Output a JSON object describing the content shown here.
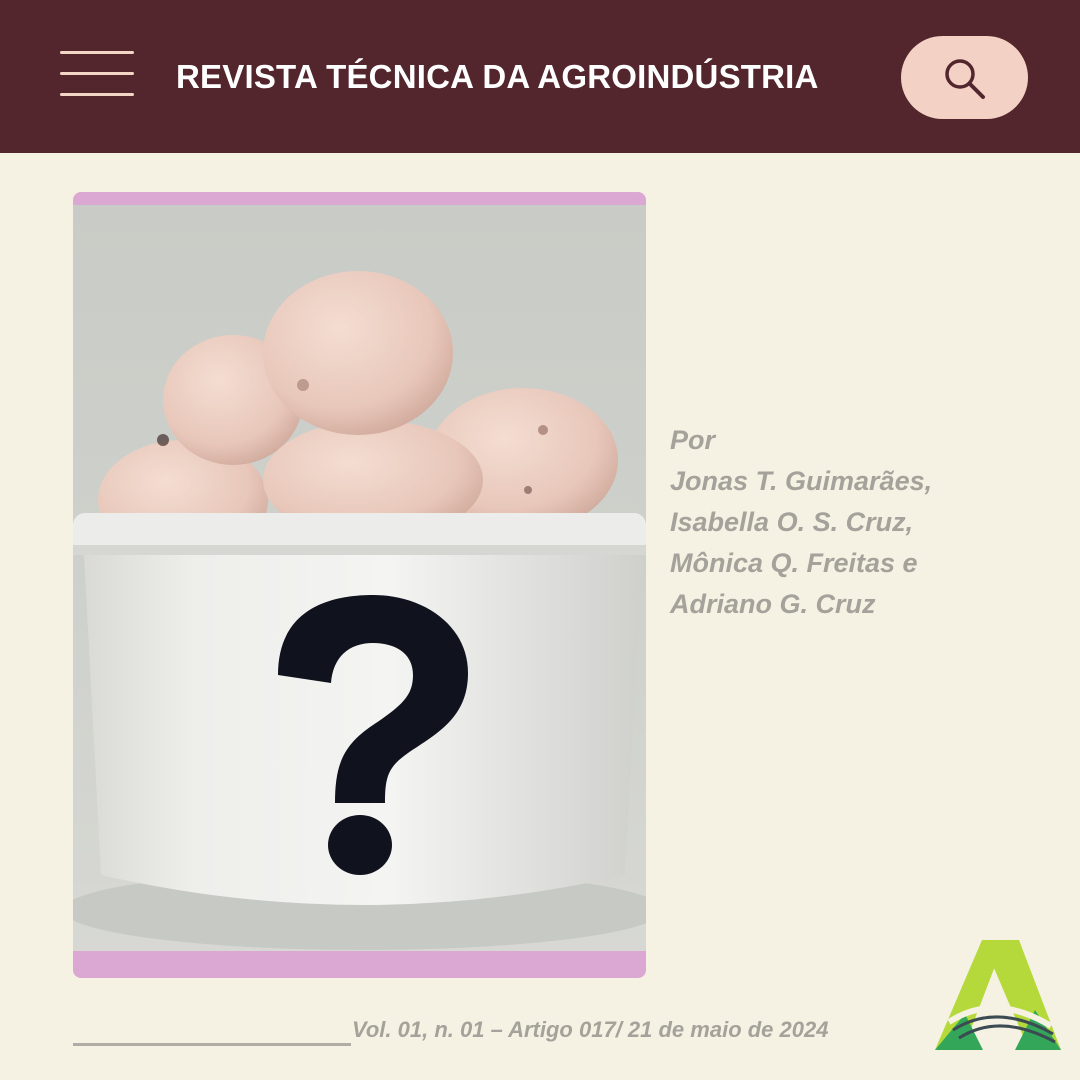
{
  "header": {
    "title": "REVISTA TÉCNICA DA AGROINDÚSTRIA",
    "menu_icon": "hamburger-menu-icon",
    "search_icon": "search-icon",
    "colors": {
      "background": "#53262e",
      "search_button": "#f3d1c4",
      "menu_lines": "#f3d6c6"
    }
  },
  "article": {
    "image_icon": "question-mark-icon",
    "byline_prefix": "Por",
    "authors": [
      "Jonas T. Guimarães,",
      "Isabella O. S. Cruz,",
      "Mônica Q. Freitas e",
      "Adriano G. Cruz"
    ]
  },
  "footer": {
    "meta": "Vol. 01, n. 01 – Artigo 017/  21 de maio de 2024",
    "logo_icon": "agroindustria-logo-icon"
  },
  "colors": {
    "page_background": "#f5f2e3",
    "image_frame": "#dba8d3",
    "muted_text": "#a5a19b"
  }
}
